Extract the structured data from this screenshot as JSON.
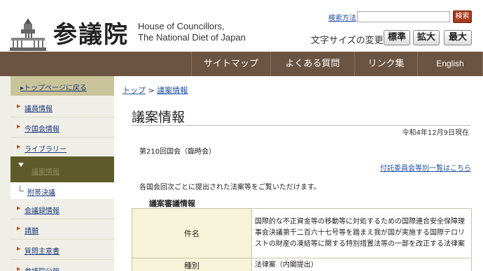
{
  "header": {
    "logo_kanji": "参議院",
    "logo_en_line1": "House of Councillors,",
    "logo_en_line2": "The National Diet of Japan",
    "search_link": "検索方法",
    "search_placeholder": "",
    "search_button": "検索",
    "fontsize_label": "文字サイズの変更",
    "fontsize_standard": "標準",
    "fontsize_large": "拡大",
    "fontsize_max": "最大"
  },
  "nav": {
    "sitemap": "サイトマップ",
    "faq": "よくある質問",
    "links": "リンク集",
    "english": "English"
  },
  "sidebar": {
    "top": "トップページに戻る",
    "items": [
      {
        "label": "議員情報"
      },
      {
        "label": "今国会情報"
      },
      {
        "label": "ライブラリー"
      }
    ],
    "active": "議案情報",
    "sub": "附帯決議",
    "items_after": [
      {
        "label": "会議録情報"
      },
      {
        "label": "請願"
      },
      {
        "label": "質問主意書"
      },
      {
        "label": "参議院公報"
      }
    ]
  },
  "main": {
    "breadcrumb_top": "トップ",
    "breadcrumb_sep": ">",
    "breadcrumb_current": "議案情報",
    "title": "議案情報",
    "date_note": "令和4年12月9日現在",
    "session": "第210回国会（臨時会）",
    "committee_link": "付託委員会等別一覧はこちら",
    "intro": "各国会回次ごとに提出された法案等をご覧いただけます。",
    "section_title": "議案審議情報",
    "table": {
      "name_header": "件名",
      "name_value": "国際的な不正資金等の移動等に対処するための国際連合安全保障理事会決議第千二百六十七号等を踏まえ我が国が実施する国際テロリストの財産の凍結等に関する特別措置法等の一部を改正する法律案",
      "type_header": "種別",
      "type_value": "法律案（内閣提出）"
    }
  },
  "colors": {
    "nav_bg": "#6b5442",
    "sidebar_active_bg": "#5e5a2a",
    "search_button_bg": "#a83a1f",
    "table_header_bg": "#f7f3d8",
    "link": "#1f4fa3"
  }
}
